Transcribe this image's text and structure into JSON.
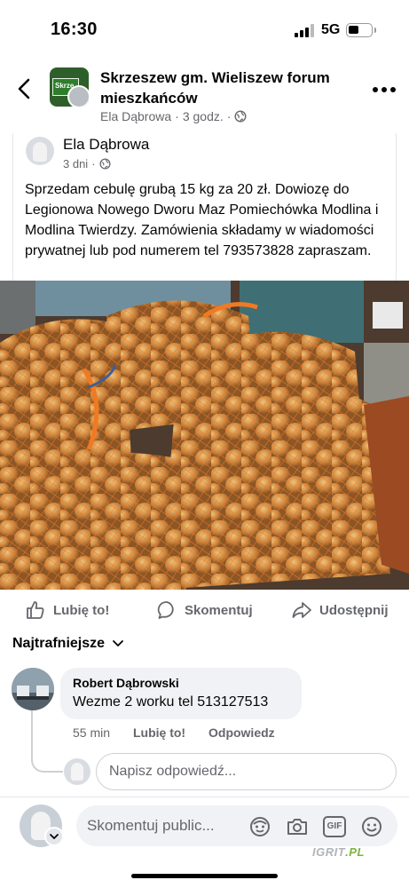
{
  "status_bar": {
    "time": "16:30",
    "network": "5G"
  },
  "header": {
    "group_name": "Skrzeszew gm. Wieliszew forum mieszkańców",
    "sharer": "Ela Dąbrowa",
    "time_ago": "3 godz.",
    "avatar_sign_text": "Skrze"
  },
  "post": {
    "author": "Ela Dąbrowa",
    "time_ago": "3 dni",
    "text": "Sprzedam cebulę grubą 15 kg za 20 zł. Dowiozę do Legionowa Nowego Dworu Maz Pomiechówka Modlina i Modlina Twierdzy. Zamówienia składamy w wiadomości prywatnej lub pod numerem tel 793573828 zapraszam."
  },
  "actions": {
    "like": "Lubię to!",
    "comment": "Skomentuj",
    "share": "Udostępnij"
  },
  "comments": {
    "sort_label": "Najtrafniejsze",
    "items": [
      {
        "author": "Robert Dąbrowski",
        "text": "Wezme 2 worku tel 513127513",
        "time_ago": "55 min",
        "like_label": "Lubię to!",
        "reply_label": "Odpowiedz"
      }
    ],
    "reply_placeholder": "Napisz odpowiedź..."
  },
  "composer": {
    "placeholder": "Skomentuj public...",
    "gif_label": "GIF"
  },
  "watermark": {
    "brand": "IGRIT",
    "suffix": ".PL"
  },
  "colors": {
    "text": "#050505",
    "secondary": "#65676b",
    "bubble": "#f0f2f5",
    "onion_net": "#f07a22"
  },
  "icons": [
    "back-arrow-icon",
    "more-icon",
    "globe-icon",
    "like-icon",
    "comment-icon",
    "share-icon",
    "chevron-down-icon",
    "avatar-sticker-icon",
    "camera-icon",
    "gif-icon",
    "emoji-icon"
  ]
}
